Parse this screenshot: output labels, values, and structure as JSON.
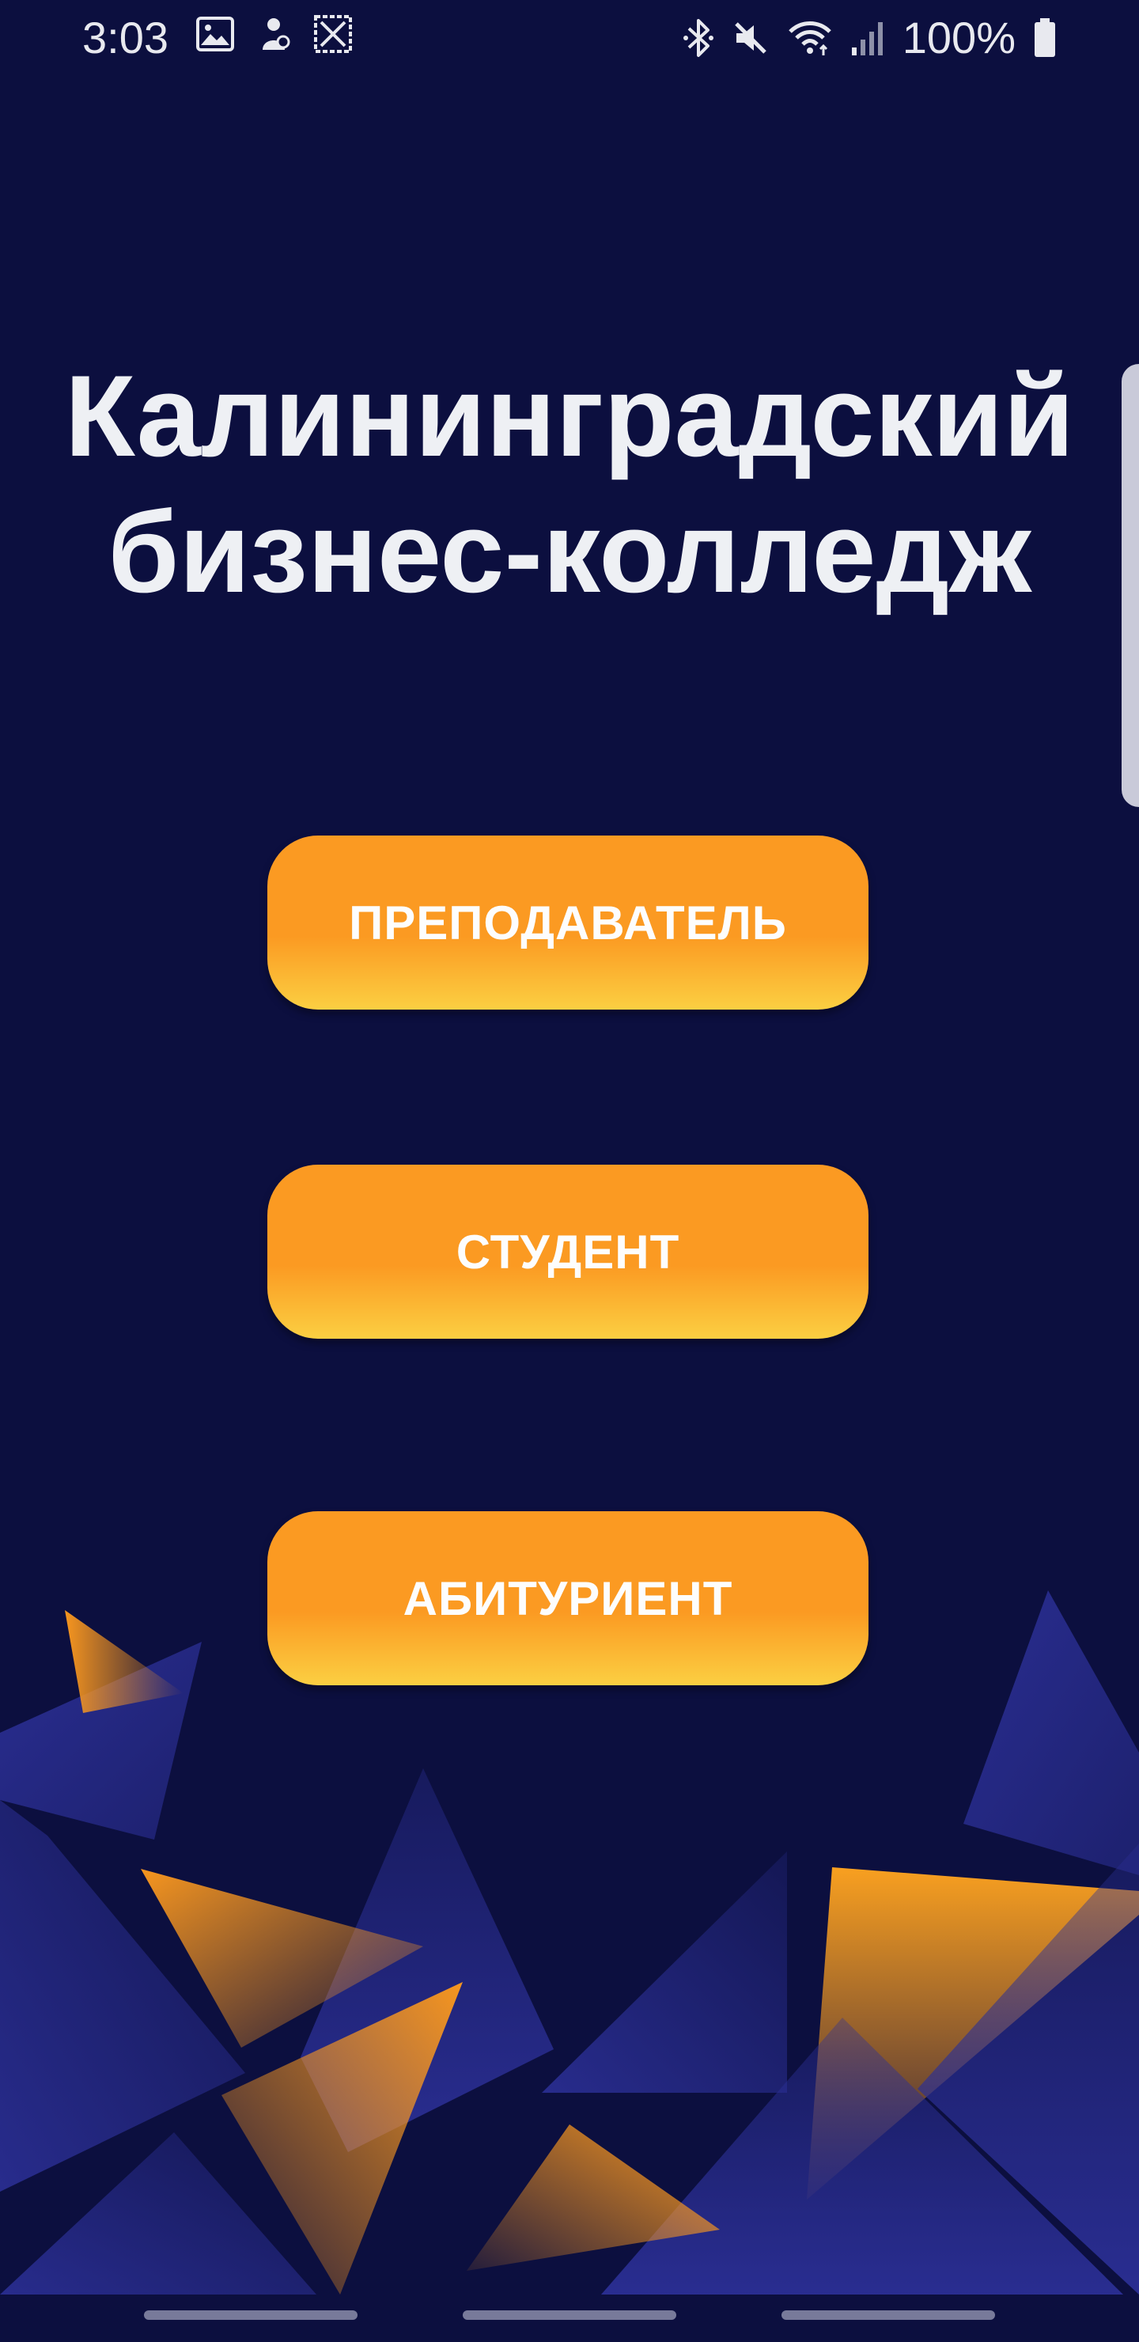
{
  "status_bar": {
    "time": "3:03",
    "left_icons": [
      "image-icon",
      "profile-notification-icon",
      "app-notification-icon"
    ],
    "right_icons": [
      "bluetooth-icon",
      "mute-icon",
      "wifi-icon",
      "cellular-signal-icon"
    ],
    "battery_text": "100%",
    "battery_icon": "battery-full-icon"
  },
  "main": {
    "title_line1": "Калининградский",
    "title_line2": "бизнес-колледж",
    "buttons": [
      {
        "label": "ПРЕПОДАВАТЕЛЬ"
      },
      {
        "label": "СТУДЕНТ"
      },
      {
        "label": "АБИТУРИЕНТ"
      }
    ]
  },
  "colors": {
    "background": "#0c0f3f",
    "button_top": "#fb9a22",
    "button_bottom": "#fbcf42",
    "triangle_blue": "#2a2f92",
    "triangle_orange": "#f5951f",
    "title_text": "#eef0f4"
  }
}
